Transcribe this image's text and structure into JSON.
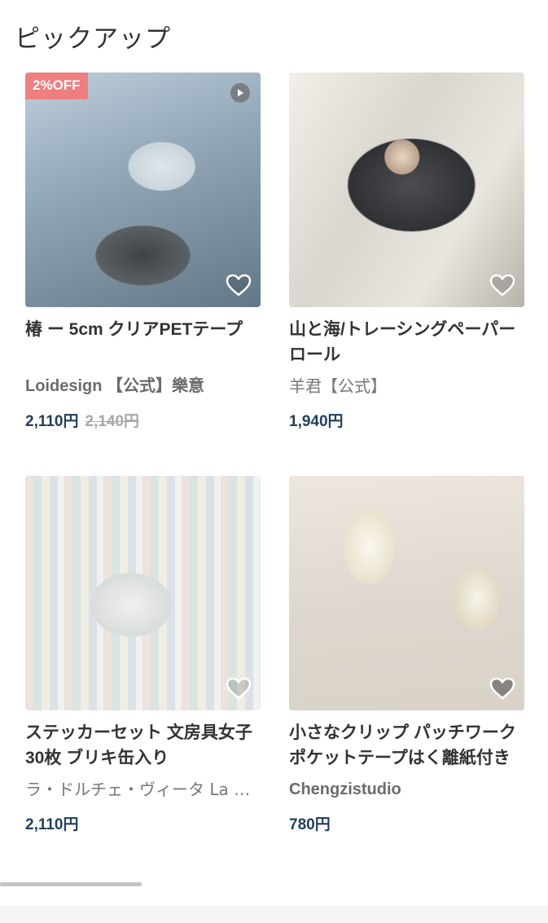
{
  "section": {
    "title": "ピックアップ"
  },
  "items": [
    {
      "badge": "2%OFF",
      "name": "椿 ー 5cm クリアPETテープ",
      "shop": "Loidesign 【公式】樂意",
      "price": "2,110円",
      "original_price": "2,140円",
      "has_video": true,
      "icons": [
        "play-icon",
        "heart-icon"
      ]
    },
    {
      "name": "山と海/トレーシングペーパーロール",
      "shop": "羊君【公式】",
      "price": "1,940円",
      "icons": [
        "heart-icon"
      ]
    },
    {
      "name": "ステッカーセット 文房具女子 30枚 ブリキ缶入り",
      "shop": "ラ・ドルチェ・ヴィータ La Dolce Vita",
      "price": "2,110円",
      "icons": [
        "heart-icon"
      ]
    },
    {
      "name": "小さなクリップ パッチワーク ポケットテープはく離紙付き",
      "shop": "Chengzistudio",
      "price": "780円",
      "icons": [
        "heart-icon"
      ]
    }
  ],
  "colors": {
    "badge": "#ef7f7f",
    "price": "#233f5c",
    "old_price": "#a8a8a8",
    "text": "#333333",
    "shop": "#777777"
  }
}
